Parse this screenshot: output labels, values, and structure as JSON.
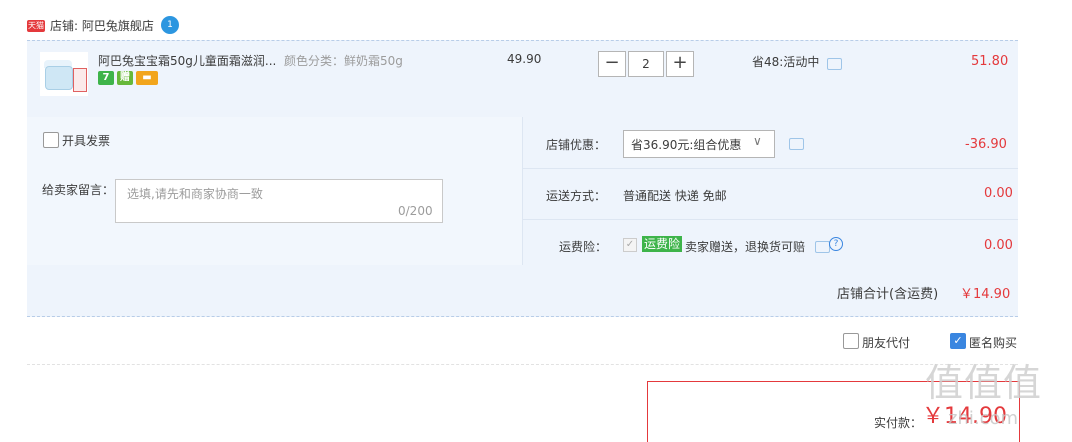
{
  "shop": {
    "badge": "天猫",
    "label": "店铺: 阿巴兔旗舰店",
    "ww_icon": "1"
  },
  "item": {
    "title": "阿巴兔宝宝霜50g儿童面霜滋润...",
    "sku": "颜色分类：鲜奶霜50g",
    "service_icons": [
      "7",
      "赠",
      "card-icon"
    ],
    "unit_price": "49.90",
    "quantity": "2",
    "qty_minus": "−",
    "qty_plus": "+",
    "promo": "省48:活动中",
    "total": "51.80"
  },
  "options": {
    "invoice_label": "开具发票",
    "message_label": "给卖家留言：",
    "message_placeholder": "选填,请先和商家协商一致",
    "message_count": "0/200",
    "coupon_label": "店铺优惠：",
    "coupon_value": "省36.90元:组合优惠",
    "coupon_amount": "-36.90",
    "ship_label": "运送方式：",
    "ship_value": "普通配送 快递 免邮",
    "ship_amount": "0.00",
    "insurance_label": "运费险：",
    "insurance_tag": "运费险",
    "insurance_text": "卖家赠送，退换货可赔",
    "insurance_amount": "0.00"
  },
  "shop_total": {
    "label": "店铺合计(含运费)",
    "amount": "￥14.90"
  },
  "pay_options": {
    "friend_pay": "朋友代付",
    "anonymous": "匿名购买",
    "anonymous_checked": true
  },
  "payment": {
    "label": "实付款：",
    "amount": "￥14.90"
  },
  "watermark": {
    "text": "值值值",
    "url": "zhi.com"
  },
  "colors": {
    "accent_red": "#e4393c",
    "row_bg": "#eef4fc",
    "check_blue": "#3a86e0",
    "tag_green": "#3eb44a"
  }
}
